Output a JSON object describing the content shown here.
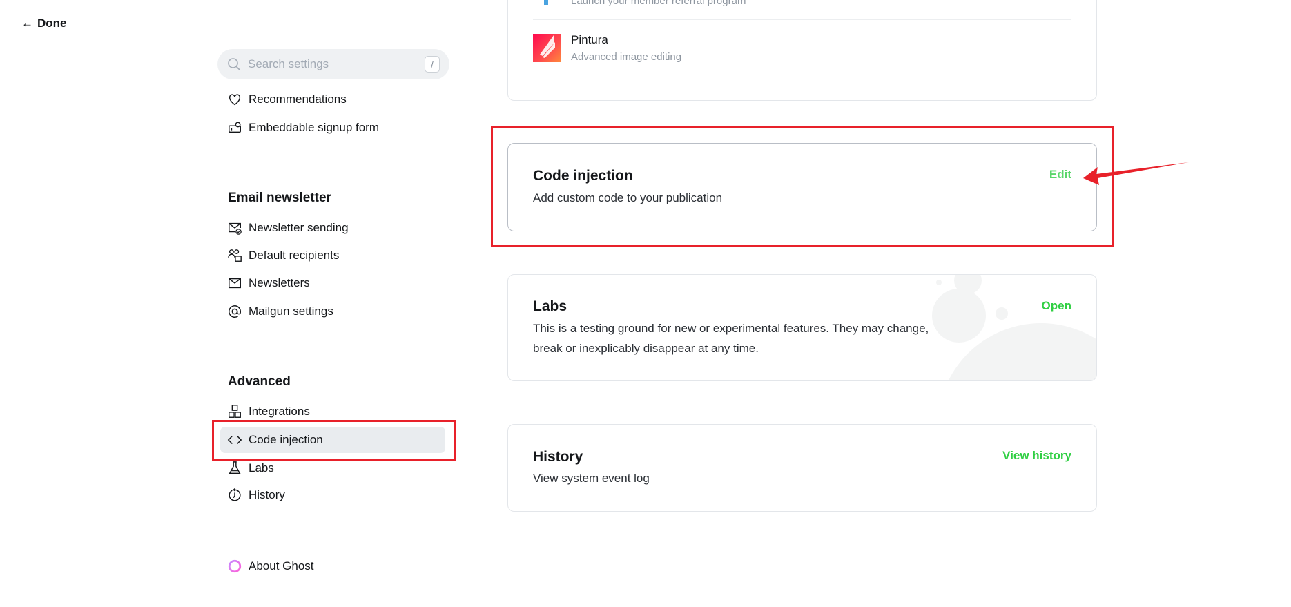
{
  "nav": {
    "done_label": "Done"
  },
  "search": {
    "placeholder": "Search settings",
    "shortcut": "/"
  },
  "sidebar": {
    "top_items": [
      {
        "label": "Recommendations",
        "icon": "heart-icon"
      },
      {
        "label": "Embeddable signup form",
        "icon": "signup-form-icon"
      }
    ],
    "email_heading": "Email newsletter",
    "email_items": [
      {
        "label": "Newsletter sending",
        "icon": "mail-check-icon"
      },
      {
        "label": "Default recipients",
        "icon": "recipients-icon"
      },
      {
        "label": "Newsletters",
        "icon": "envelope-icon"
      },
      {
        "label": "Mailgun settings",
        "icon": "at-icon"
      }
    ],
    "advanced_heading": "Advanced",
    "advanced_items": [
      {
        "label": "Integrations",
        "icon": "blocks-icon"
      },
      {
        "label": "Code injection",
        "icon": "code-icon",
        "active": true
      },
      {
        "label": "Labs",
        "icon": "flask-icon"
      },
      {
        "label": "History",
        "icon": "history-icon"
      }
    ],
    "about_label": "About Ghost"
  },
  "integrations_card": {
    "partial_item_desc": "Launch your member referral program",
    "pintura": {
      "name": "Pintura",
      "desc": "Advanced image editing"
    }
  },
  "code_injection": {
    "title": "Code injection",
    "desc": "Add custom code to your publication",
    "action": "Edit"
  },
  "labs": {
    "title": "Labs",
    "desc": "This is a testing ground for new or experimental features. They may change, break or inexplicably disappear at any time.",
    "action": "Open"
  },
  "history": {
    "title": "History",
    "desc": "View system event log",
    "action": "View history"
  },
  "colors": {
    "accent": "#30cf43",
    "annotation": "#e8212a",
    "active_bg": "#e9ecef"
  }
}
